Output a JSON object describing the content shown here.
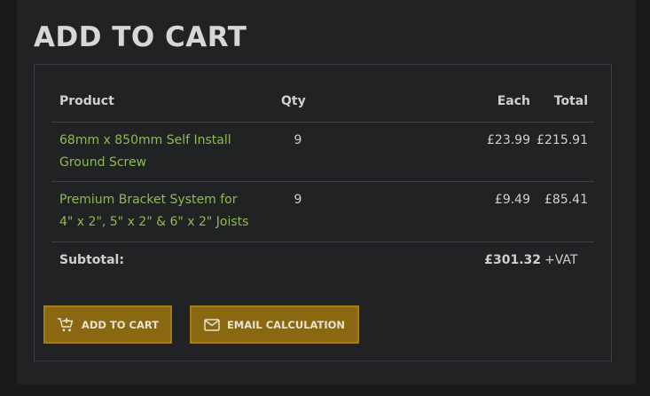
{
  "page": {
    "title": "ADD TO CART"
  },
  "table": {
    "headers": {
      "product": "Product",
      "qty": "Qty",
      "each": "Each",
      "total": "Total"
    },
    "rows": [
      {
        "product_line1": "68mm x 850mm Self Install",
        "product_line2": "Ground Screw",
        "qty": "9",
        "each": "£23.99",
        "total": "£215.91"
      },
      {
        "product_line1": "Premium Bracket System for",
        "product_line2": "4\" x 2\", 5\" x 2\" & 6\" x 2\" Joists",
        "qty": "9",
        "each": "£9.49",
        "total": "£85.41"
      }
    ],
    "subtotal": {
      "label": "Subtotal:",
      "value": "£301.32",
      "suffix": "+VAT"
    }
  },
  "buttons": {
    "add_to_cart": {
      "label": "ADD TO CART",
      "icon": "cart-plus-icon"
    },
    "email_calculation": {
      "label": "EMAIL CALCULATION",
      "icon": "envelope-icon"
    }
  },
  "colors": {
    "accent": "#8a6711",
    "link": "#8dbb4f",
    "background": "#212224"
  }
}
